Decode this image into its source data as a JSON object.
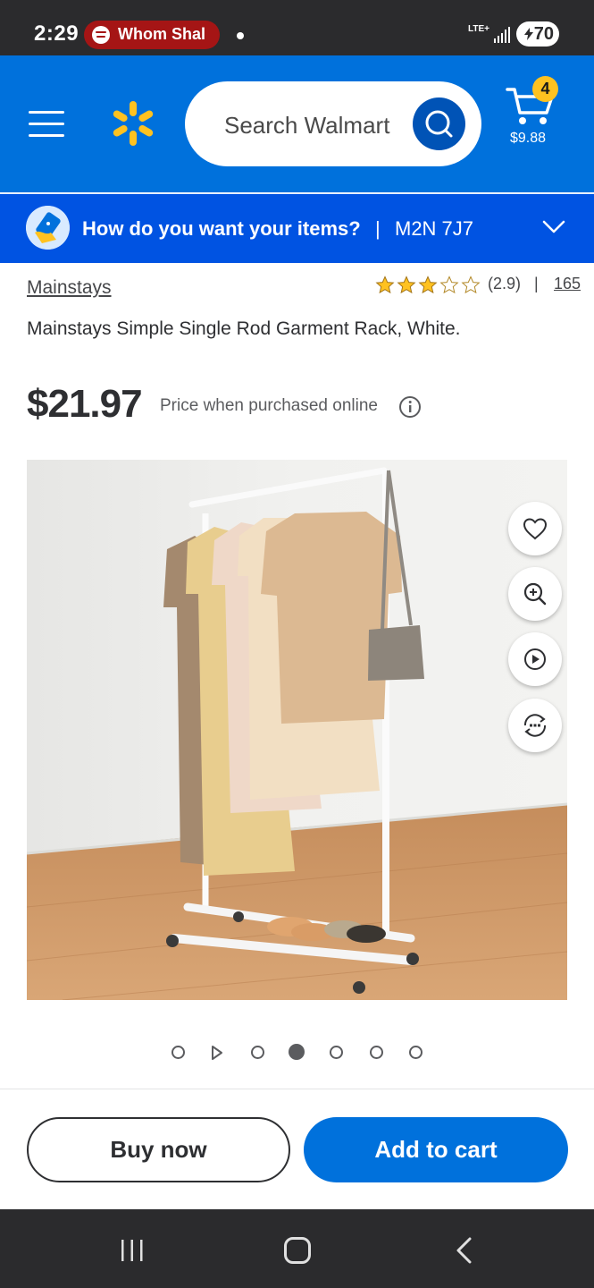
{
  "status_bar": {
    "time": "2:29",
    "media_label": "Whom Shal",
    "network": "LTE+",
    "battery": "70"
  },
  "header": {
    "search_placeholder": "Search Walmart",
    "cart_count": "4",
    "cart_total": "$9.88",
    "brand_color": "#0071dc",
    "spark_color": "#ffc220"
  },
  "fulfillment": {
    "question": "How do you want your items?",
    "separator": "|",
    "postal_code": "M2N 7J7"
  },
  "product": {
    "brand": "Mainstays",
    "rating": "(2.9)",
    "rating_value": 2.9,
    "rating_max": 5,
    "rating_separator": "|",
    "review_count": "165",
    "title": "Mainstays Simple Single Rod Garment Rack, White.",
    "price": "$21.97",
    "price_note": "Price when purchased online"
  },
  "image_actions": [
    "heart-icon",
    "zoom-in-icon",
    "play-icon",
    "rotate-360-icon"
  ],
  "carousel": {
    "items": [
      "dot",
      "play",
      "dot",
      "dot",
      "dot",
      "dot",
      "dot"
    ],
    "active_index": 3
  },
  "actions": {
    "buy_now": "Buy now",
    "add_to_cart": "Add to cart"
  },
  "nav": [
    "recents-icon",
    "home-icon",
    "back-icon"
  ]
}
